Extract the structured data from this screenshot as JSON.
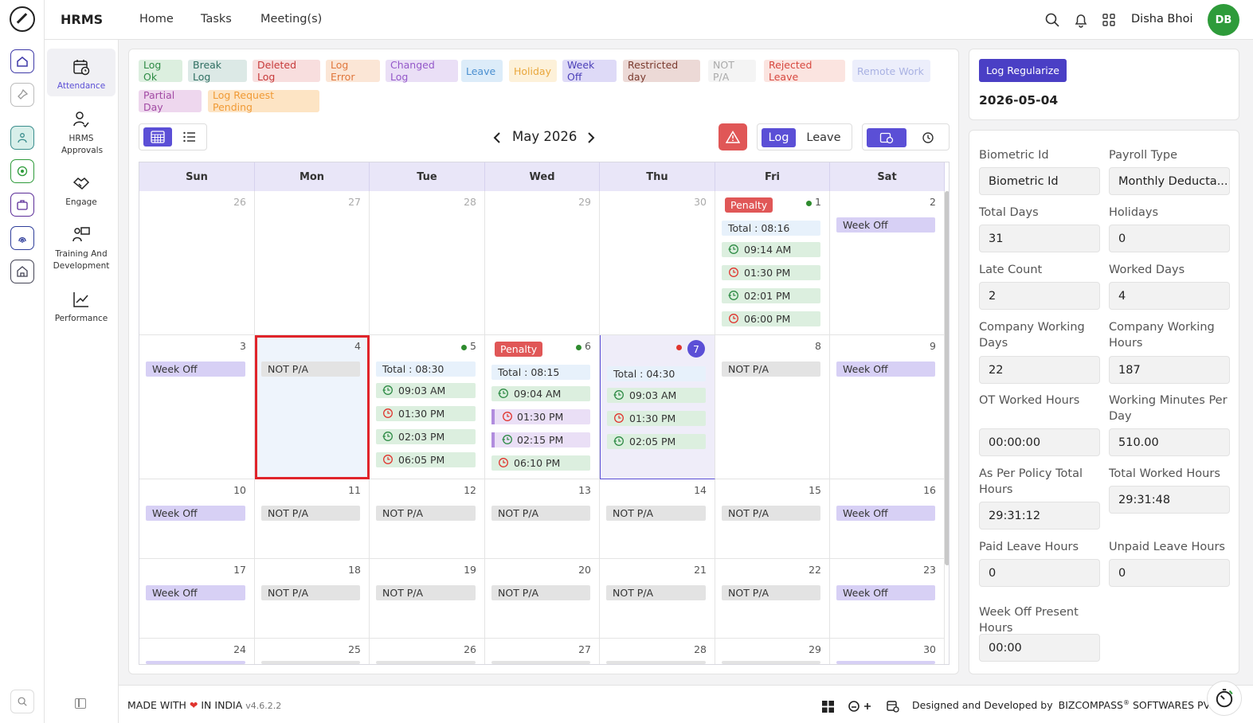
{
  "app": {
    "brand": "HRMS"
  },
  "topnav": {
    "items": [
      "Home",
      "Tasks",
      "Meeting(s)"
    ],
    "user_name": "Disha Bhoi",
    "avatar_initials": "DB"
  },
  "sidenav": {
    "items": [
      {
        "label": "Attendance",
        "icon": "calendar-clock-icon",
        "active": true
      },
      {
        "label": "HRMS Approvals",
        "icon": "user-check-icon"
      },
      {
        "label": "Engage",
        "icon": "handshake-icon"
      },
      {
        "label": "Training And Development",
        "icon": "presentation-icon"
      },
      {
        "label": "Performance",
        "icon": "chart-line-icon"
      }
    ]
  },
  "legend": [
    {
      "label": "Log Ok",
      "bg": "#dcefdf",
      "fg": "#2e8b45"
    },
    {
      "label": "Break Log",
      "bg": "#dce9e6",
      "fg": "#2f6f62"
    },
    {
      "label": "Deleted Log",
      "bg": "#f8dede",
      "fg": "#c73a3a"
    },
    {
      "label": "Log Error",
      "bg": "#fbe6d6",
      "fg": "#e0773c"
    },
    {
      "label": "Changed Log",
      "bg": "#eadff6",
      "fg": "#9458c9"
    },
    {
      "label": "Leave",
      "bg": "#dcecf9",
      "fg": "#4a8fd0"
    },
    {
      "label": "Holiday",
      "bg": "#fdf1d9",
      "fg": "#e9a73c"
    },
    {
      "label": "Week Off",
      "bg": "#dedaf7",
      "fg": "#4b3fb8"
    },
    {
      "label": "Restricted day",
      "bg": "#ecd9d6",
      "fg": "#7a3a2e"
    },
    {
      "label": "NOT P/A",
      "bg": "#f4f4f4",
      "fg": "#aaaaaa"
    },
    {
      "label": "Rejected Leave",
      "bg": "#fbe4e0",
      "fg": "#d7473e"
    },
    {
      "label": "Remote Work",
      "bg": "#eceefb",
      "fg": "#a9b2e3"
    },
    {
      "label": "Partial Day",
      "bg": "#eed7ee",
      "fg": "#a24aa4"
    },
    {
      "label": "Log Request Pending",
      "bg": "#fde4c4",
      "fg": "#f09a35"
    }
  ],
  "calendar": {
    "month_label": "May 2026",
    "toggle": {
      "log": "Log",
      "leave": "Leave"
    },
    "weekdays": [
      "Sun",
      "Mon",
      "Tue",
      "Wed",
      "Thu",
      "Fri",
      "Sat"
    ],
    "weeks": [
      [
        {
          "day": "26",
          "muted": true
        },
        {
          "day": "27",
          "muted": true
        },
        {
          "day": "28",
          "muted": true
        },
        {
          "day": "29",
          "muted": true
        },
        {
          "day": "30",
          "muted": true
        },
        {
          "day": "1",
          "penalty": "Penalty",
          "dot": "#2e8b2e",
          "total": "Total : 08:16",
          "logs": [
            {
              "t": "09:14 AM",
              "k": "in"
            },
            {
              "t": "01:30 PM",
              "k": "out"
            },
            {
              "t": "02:01 PM",
              "k": "in"
            },
            {
              "t": "06:00 PM",
              "k": "out"
            }
          ]
        },
        {
          "day": "2",
          "status": "Week Off"
        }
      ],
      [
        {
          "day": "3",
          "status": "Week Off"
        },
        {
          "day": "4",
          "status": "NOT P/A",
          "selected": true
        },
        {
          "day": "5",
          "dot": "#2e8b2e",
          "total": "Total : 08:30",
          "logs": [
            {
              "t": "09:03 AM",
              "k": "in"
            },
            {
              "t": "01:30 PM",
              "k": "out"
            },
            {
              "t": "02:03 PM",
              "k": "in"
            },
            {
              "t": "06:05 PM",
              "k": "out"
            }
          ]
        },
        {
          "day": "6",
          "penalty": "Penalty",
          "dot": "#2e8b2e",
          "total": "Total : 08:15",
          "logs": [
            {
              "t": "09:04 AM",
              "k": "in"
            },
            {
              "t": "01:30 PM",
              "k": "chg"
            },
            {
              "t": "02:15 PM",
              "k": "chgin"
            },
            {
              "t": "06:10 PM",
              "k": "out"
            }
          ]
        },
        {
          "day": "7",
          "today": true,
          "dot": "#e0342e",
          "total": "Total : 04:30",
          "logs": [
            {
              "t": "09:03 AM",
              "k": "in"
            },
            {
              "t": "01:30 PM",
              "k": "out"
            },
            {
              "t": "02:05 PM",
              "k": "in"
            }
          ]
        },
        {
          "day": "8",
          "status": "NOT P/A"
        },
        {
          "day": "9",
          "status": "Week Off"
        }
      ],
      [
        {
          "day": "10",
          "status": "Week Off"
        },
        {
          "day": "11",
          "status": "NOT P/A"
        },
        {
          "day": "12",
          "status": "NOT P/A"
        },
        {
          "day": "13",
          "status": "NOT P/A"
        },
        {
          "day": "14",
          "status": "NOT P/A"
        },
        {
          "day": "15",
          "status": "NOT P/A"
        },
        {
          "day": "16",
          "status": "Week Off"
        }
      ],
      [
        {
          "day": "17",
          "status": "Week Off"
        },
        {
          "day": "18",
          "status": "NOT P/A"
        },
        {
          "day": "19",
          "status": "NOT P/A"
        },
        {
          "day": "20",
          "status": "NOT P/A"
        },
        {
          "day": "21",
          "status": "NOT P/A"
        },
        {
          "day": "22",
          "status": "NOT P/A"
        },
        {
          "day": "23",
          "status": "Week Off"
        }
      ],
      [
        {
          "day": "24"
        },
        {
          "day": "25"
        },
        {
          "day": "26"
        },
        {
          "day": "27"
        },
        {
          "day": "28"
        },
        {
          "day": "29"
        },
        {
          "day": "30"
        }
      ]
    ]
  },
  "regularize": {
    "button": "Log Regularize",
    "date": "2026-05-04"
  },
  "summary": [
    {
      "label": "Biometric Id",
      "value": "Biometric Id"
    },
    {
      "label": "Payroll Type",
      "value": "Monthly Deducta..."
    },
    {
      "label": "Total Days",
      "value": "31"
    },
    {
      "label": "Holidays",
      "value": "0"
    },
    {
      "label": "Late Count",
      "value": "2"
    },
    {
      "label": "Worked Days",
      "value": "4"
    },
    {
      "label": "Company Working Days",
      "value": "22"
    },
    {
      "label": "Company Working Hours",
      "value": "187"
    },
    {
      "label": "OT Worked Hours",
      "value": "00:00:00"
    },
    {
      "label": "Working Minutes Per Day",
      "value": "510.00"
    },
    {
      "label": "As Per Policy Total Hours",
      "value": "29:31:12"
    },
    {
      "label": "Total Worked Hours",
      "value": "29:31:48"
    },
    {
      "label": "Paid Leave Hours",
      "value": "0"
    },
    {
      "label": "Unpaid Leave Hours",
      "value": "0"
    },
    {
      "label": "Week Off Present Hours",
      "value": "00:00"
    }
  ],
  "footer": {
    "made_prefix": "MADE WITH",
    "made_suffix": "IN INDIA",
    "version": "v4.6.2.2",
    "designed_by": "Designed and Developed by",
    "company": "BIZCOMPASS",
    "company_suffix": "SOFTWARES PVT"
  }
}
